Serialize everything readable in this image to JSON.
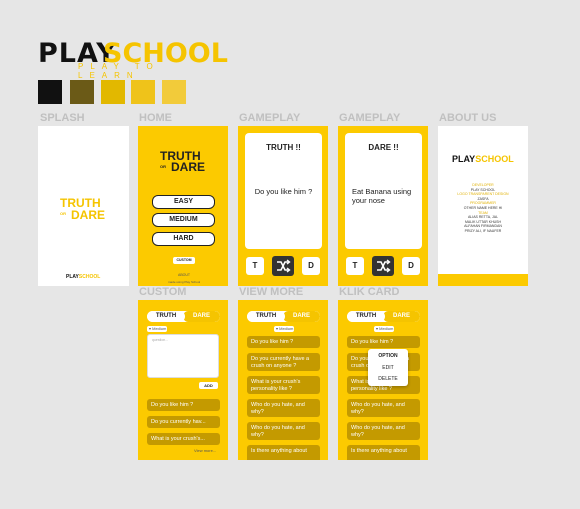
{
  "brand": {
    "play": "PLAY",
    "school": "SCHOOL",
    "tagline": "PLAY TO LEARN"
  },
  "palette": [
    "#111111",
    "#6b5a17",
    "#e2b800",
    "#efc31a",
    "#f2cb3a"
  ],
  "sections": {
    "splash": "SPLASH",
    "home": "HOME",
    "gameplay1": "GAMEPLAY",
    "gameplay2": "GAMEPLAY",
    "about": "ABOUT US",
    "custom": "CUSTOM",
    "view_more": "VIEW MORE",
    "klik_card": "KLIK CARD"
  },
  "splash": {
    "truth": "TRUTH",
    "or": "OR",
    "dare": "DARE",
    "brand_play": "PLAY",
    "brand_school": "SCHOOL"
  },
  "home": {
    "truth": "TRUTH",
    "or": "OR",
    "dare": "DARE",
    "easy": "EASY",
    "medium": "MEDIUM",
    "hard": "HARD",
    "custom": "CUSTOM",
    "about": "ABOUT",
    "footer": "made using Play School"
  },
  "gameplay_truth": {
    "title": "TRUTH !!",
    "question": "Do you like him ?",
    "t": "T",
    "d": "D"
  },
  "gameplay_dare": {
    "title": "DARE !!",
    "question": "Eat Banana using your nose",
    "t": "T",
    "d": "D"
  },
  "about": {
    "brand_play": "PLAY",
    "brand_school": "SCHOOL",
    "lines": [
      "DEVELOPER",
      "PLAY SCHOOL",
      "",
      "LOGO TRANSPARENT DESIGN",
      "ZASFA",
      "",
      "PROGRAMMER",
      "OTHER NAME HERE HI",
      "",
      "TEAM",
      "ALIAS RETTA, JAL",
      "MALIK UTTAR KHUSH",
      "ALFAHAN FIRMANDAN",
      "PRIZY ALI, IF NAUFER"
    ]
  },
  "custom": {
    "tab_truth": "TRUTH",
    "tab_dare": "DARE",
    "level": "Medium",
    "placeholder": "question...",
    "add": "ADD",
    "items": [
      "Do you like him ?",
      "Do you currently hav...",
      "What is your crush's..."
    ],
    "view_more": "View more..."
  },
  "view_more": {
    "tab_truth": "TRUTH",
    "tab_dare": "DARE",
    "level": "Medium",
    "items": [
      "Do you like him ?",
      "Do you currently have a crush on anyone ?",
      "What is your crush's personality like ?",
      "Who do you hate, and why?",
      "Who do you hate, and why?",
      "Is there anything about"
    ]
  },
  "klik_card": {
    "tab_truth": "TRUTH",
    "tab_dare": "DARE",
    "level": "Medium",
    "items": [
      "Do you like him ?",
      "Do you currently have a crush on anyone ?",
      "What is your crush's personality like ?",
      "Who do you hate, and why?",
      "Who do you hate, and why?",
      "Is there anything about"
    ],
    "menu_title": "OPTION",
    "menu_edit": "EDIT",
    "menu_delete": "DELETE"
  }
}
